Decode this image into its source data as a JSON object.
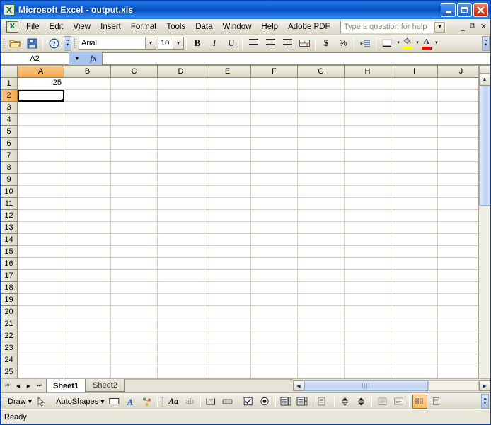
{
  "window": {
    "title": "Microsoft Excel - output.xls",
    "app_icon": "excel-icon",
    "minimize": "–",
    "maximize": "□",
    "close": "✕"
  },
  "menubar": {
    "items": [
      {
        "label": "File",
        "accel": "F"
      },
      {
        "label": "Edit",
        "accel": "E"
      },
      {
        "label": "View",
        "accel": "V"
      },
      {
        "label": "Insert",
        "accel": "I"
      },
      {
        "label": "Format",
        "accel": "o"
      },
      {
        "label": "Tools",
        "accel": "T"
      },
      {
        "label": "Data",
        "accel": "D"
      },
      {
        "label": "Window",
        "accel": "W"
      },
      {
        "label": "Help",
        "accel": "H"
      },
      {
        "label": "Adobe PDF",
        "accel": "e"
      }
    ],
    "ask_placeholder": "Type a question for help",
    "ask_value": "",
    "doc_minimize": "–",
    "doc_restore": "❐",
    "doc_close": "✕"
  },
  "toolbar": {
    "open_icon": "open-folder-icon",
    "save_icon": "save-disk-icon",
    "help_icon": "help-question-icon",
    "font_name": "Arial",
    "font_size": "10",
    "bold": "B",
    "italic": "I",
    "underline": "U",
    "currency": "$",
    "percent": "%",
    "fill_color": "#FFFF00",
    "font_color": "#FF0000",
    "overflow": "»"
  },
  "formulabar": {
    "name_box": "A2",
    "fx": "fx",
    "formula_value": ""
  },
  "grid": {
    "columns": [
      "A",
      "B",
      "C",
      "D",
      "E",
      "F",
      "G",
      "H",
      "I",
      "J"
    ],
    "selected_column": "A",
    "selected_row": 2,
    "rows": [
      1,
      2,
      3,
      4,
      5,
      6,
      7,
      8,
      9,
      10,
      11,
      12,
      13,
      14,
      15,
      16,
      17,
      18,
      19,
      20,
      21,
      22,
      23,
      24,
      25
    ],
    "cells": {
      "A1": "25",
      "A2": ""
    },
    "active_cell": "A2"
  },
  "sheettabs": {
    "nav_first": "◀❘",
    "nav_prev": "◀",
    "nav_next": "▶",
    "nav_last": "❘▶",
    "tabs": [
      {
        "label": "Sheet1",
        "active": true
      },
      {
        "label": "Sheet2",
        "active": false
      }
    ]
  },
  "scrollbars": {
    "v_up": "▲",
    "v_down": "▼",
    "h_left": "◀",
    "h_right": "▶",
    "h_grip": "||||"
  },
  "drawbar": {
    "draw_label": "Draw",
    "draw_arrow": "▾",
    "select_icon": "arrow-pointer-icon",
    "autoshapes_label": "AutoShapes",
    "autoshapes_arrow": "▾",
    "rectangle_icon": "rectangle-icon",
    "wordart_icon": "wordart-icon",
    "diagram_icon": "diagram-icon",
    "label_icon": "label-Aa-icon",
    "textbox_icon": "text-box-ab-icon",
    "combo_icon": "combo-box-icon",
    "button_icon": "button-icon",
    "checkbox_icon": "checkbox-icon",
    "radio_icon": "radio-button-icon",
    "listbox_icon": "list-box-icon",
    "dropdown_icon": "drop-down-icon",
    "listedit_icon": "list-edit-icon",
    "scroll_icon": "scroll-bar-icon",
    "spinner_icon": "spinner-icon",
    "props_icon": "properties-icon",
    "code_icon": "view-code-icon",
    "toggle_grid_icon": "toggle-grid-icon",
    "run_icon": "run-dialog-icon"
  },
  "statusbar": {
    "status": "Ready"
  }
}
